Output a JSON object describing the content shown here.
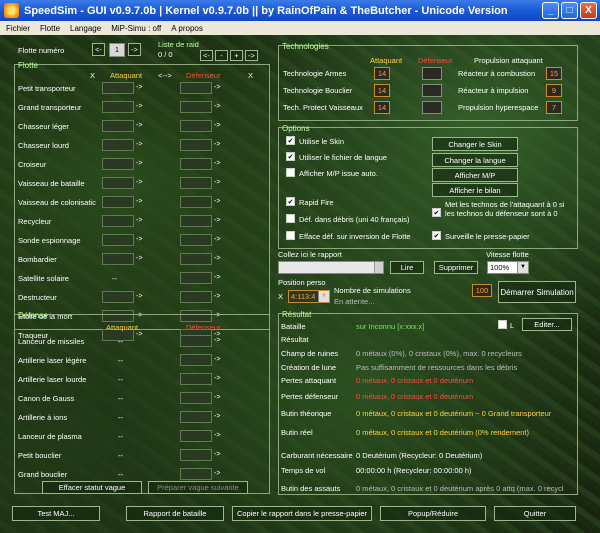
{
  "window": {
    "title": "SpeedSim - GUI v0.9.7.0b | Kernel v0.9.7.0b || by RainOfPain & TheButcher - Unicode Version",
    "minimize": "_",
    "maximize": "□",
    "close": "X"
  },
  "menu": [
    "Fichier",
    "Flotte",
    "Langage",
    "MiP-Simu : off",
    "A propos"
  ],
  "flotte_numero": {
    "label": "Flotte numéro",
    "prev": "<-",
    "value": "1",
    "next": "->"
  },
  "liste_raid": {
    "label": "Liste de raid",
    "count": "0 / 0",
    "prev": "<-",
    "minus": "-",
    "plus": "+",
    "next": "->"
  },
  "flotte": {
    "title": "Flotte",
    "x_label": "X",
    "attaquant": "Attaquant",
    "swap": "<-->",
    "defenseur": "Défenseur",
    "arrow": "->",
    "ships": [
      "Petit transporteur",
      "Grand transporteur",
      "Chasseur léger",
      "Chasseur lourd",
      "Croiseur",
      "Vaisseau de bataille",
      "Vaisseau de colonisatic",
      "Recycleur",
      "Sonde espionnage",
      "Bombardier",
      "Satellite solaire",
      "Destructeur",
      "Étoile de la mort",
      "Traqueur"
    ],
    "satellite_attacker": "--"
  },
  "defense": {
    "title": "Défense",
    "attaquant": "Attaquant",
    "defenseur": "Défenseur",
    "dash": "--",
    "arrow": "->",
    "items": [
      "Lanceur de missiles",
      "Artillerie laser légère",
      "Artillerie laser lourde",
      "Canon de Gauss",
      "Artillerie à ions",
      "Lanceur de plasma",
      "Petit bouclier",
      "Grand bouclier"
    ],
    "btn_clear": "Effacer statut vague",
    "btn_next": "Préparer vague suivante"
  },
  "technologies": {
    "title": "Technologies",
    "attaquant": "Attaquant",
    "defenseur": "Défenseur",
    "propulsion": "Propulsion attaquant",
    "rows": [
      {
        "label": "Technologie Armes",
        "att": "14",
        "def": ""
      },
      {
        "label": "Technologie Bouclier",
        "att": "14",
        "def": ""
      },
      {
        "label": "Tech. Protect Vaisseaux",
        "att": "14",
        "def": ""
      }
    ],
    "engines": [
      {
        "label": "Réacteur à combustion",
        "value": "15"
      },
      {
        "label": "Réacteur à impulsion",
        "value": "9"
      },
      {
        "label": "Propulsion hyperespace",
        "value": "7"
      }
    ]
  },
  "options": {
    "title": "Options",
    "checks": [
      {
        "label": "Utilise le Skin",
        "checked": true
      },
      {
        "label": "Utiliser le fichier de langue",
        "checked": true
      },
      {
        "label": "Afficher M/P issue auto.",
        "checked": false
      },
      {
        "label": "Rapid Fire",
        "checked": true
      },
      {
        "label": "Déf. dans débris (uni 40 français)",
        "checked": false
      },
      {
        "label": "Efface déf. sur inversion de Flotte",
        "checked": false
      }
    ],
    "right_checks": [
      {
        "label": "Met les technos de l'attaquant à 0 si les technos du défenseur sont à 0",
        "checked": true
      },
      {
        "label": "Surveille le presse-papier",
        "checked": true
      }
    ],
    "buttons": [
      "Changer le Skin",
      "Changer la langue",
      "Afficher M/P",
      "Afficher le bilan"
    ]
  },
  "rapport": {
    "label": "Collez ici le rapport",
    "lire": "Lire",
    "supprimer": "Supprimer",
    "vitesse_label": "Vitesse flotte",
    "vitesse_value": "100%"
  },
  "position": {
    "label": "Position perso",
    "x": "X",
    "value": "4:113:4",
    "nb_label": "Nombre de simulations",
    "nb_value": "100",
    "status": "En attente...",
    "start": "Démarrer Simulation"
  },
  "resultat": {
    "title": "Résultat",
    "l_label": "L",
    "editer": "Editer...",
    "rows": [
      {
        "label": "Bataille",
        "value": "sur Inconnu [x:xxx:x]",
        "color": "#7fe06a"
      },
      {
        "label": "Résultat",
        "value": "",
        "color": "#ffffff"
      },
      {
        "label": "Champ de ruines",
        "value": "0 métaux (0%), 0 cristaux (0%), max. 0 recycleurs",
        "color": "#bbbbbb"
      },
      {
        "label": "Création de lune",
        "value": "Pas suffisamment de ressources dans les débris",
        "color": "#bbbbbb"
      },
      {
        "label": "Pertes attaquant",
        "value": "0 métaux, 0 cristaux et 0 deutérium",
        "color": "#ff4a3a"
      },
      {
        "label": "Pertes défenseur",
        "value": "0 métaux, 0 cristaux et 0 deutérium",
        "color": "#ff4a3a"
      },
      {
        "label": "Butin théorique",
        "value": "0 métaux, 0 cristaux et 0 deutérium ~ 0 Grand transporteur",
        "color": "#ffd23f"
      },
      {
        "label": "Butin réel",
        "value": "0 métaux, 0 cristaux et 0 deutérium (0% rendement)",
        "color": "#ffd23f"
      },
      {
        "label": "Carburant nécessaire",
        "value": "0 Deutérium (Recycleur: 0 Deutérium)",
        "color": "#ffffff"
      },
      {
        "label": "Temps de vol",
        "value": "00:00:00 h (Recycleur: 00:00:00 h)",
        "color": "#ffffff"
      },
      {
        "label": "Butin des assauts",
        "value": "0 métaux, 0 cristaux et 0 deutérium après 0 attq (max. 0 recycl",
        "color": "#bbbbbb"
      }
    ]
  },
  "bottom": [
    "Test MAJ...",
    "Rapport de bataille",
    "Copier le rapport dans le presse-papier",
    "Popup/Réduire",
    "Quitter"
  ]
}
